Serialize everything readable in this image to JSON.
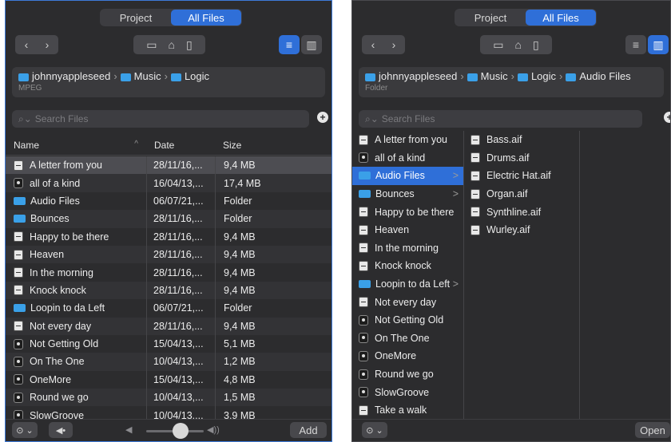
{
  "tabs": {
    "project": "Project",
    "all_files": "All Files"
  },
  "toolbar": {
    "back": "‹",
    "forward": "›",
    "computer_icon": "computer-icon",
    "home_icon": "home-icon",
    "document_icon": "document-icon",
    "list_icon": "list-view-icon",
    "column_icon": "column-view-icon"
  },
  "left": {
    "path": {
      "user": "johnnyappleseed",
      "music": "Music",
      "logic": "Logic"
    },
    "kind": "MPEG",
    "search_placeholder": "Search Files",
    "columns": {
      "name": "Name",
      "date": "Date",
      "size": "Size",
      "sort_indicator": "^"
    },
    "rows": [
      {
        "name": "A letter from you",
        "date": "28/11/16,...",
        "size": "9,4 MB",
        "type": "audio"
      },
      {
        "name": "all of a kind",
        "date": "16/04/13,...",
        "size": "17,4 MB",
        "type": "logic"
      },
      {
        "name": "Audio Files",
        "date": "06/07/21,...",
        "size": "Folder",
        "type": "folder"
      },
      {
        "name": "Bounces",
        "date": "28/11/16,...",
        "size": "Folder",
        "type": "folder"
      },
      {
        "name": "Happy to be there",
        "date": "28/11/16,...",
        "size": "9,4 MB",
        "type": "audio"
      },
      {
        "name": "Heaven",
        "date": "28/11/16,...",
        "size": "9,4 MB",
        "type": "audio"
      },
      {
        "name": "In the morning",
        "date": "28/11/16,...",
        "size": "9,4 MB",
        "type": "audio"
      },
      {
        "name": "Knock knock",
        "date": "28/11/16,...",
        "size": "9,4 MB",
        "type": "audio"
      },
      {
        "name": "Loopin to da Left",
        "date": "06/07/21,...",
        "size": "Folder",
        "type": "folder"
      },
      {
        "name": "Not every day",
        "date": "28/11/16,...",
        "size": "9,4 MB",
        "type": "audio"
      },
      {
        "name": "Not Getting Old",
        "date": "15/04/13,...",
        "size": "5,1 MB",
        "type": "logic"
      },
      {
        "name": "On The One",
        "date": "10/04/13,...",
        "size": "1,2 MB",
        "type": "logic"
      },
      {
        "name": "OneMore",
        "date": "15/04/13,...",
        "size": "4,8 MB",
        "type": "logic"
      },
      {
        "name": "Round we go",
        "date": "10/04/13,...",
        "size": "1,5 MB",
        "type": "logic"
      },
      {
        "name": "SlowGroove",
        "date": "10/04/13,...",
        "size": "3,9 MB",
        "type": "logic"
      }
    ],
    "add_label": "Add",
    "options_label": "⊙ ⌄",
    "play_label": "◀•"
  },
  "right": {
    "path": {
      "user": "johnnyappleseed",
      "music": "Music",
      "logic": "Logic",
      "audio": "Audio Files"
    },
    "kind": "Folder",
    "search_placeholder": "Search Files",
    "col1": [
      {
        "name": "A letter from you",
        "type": "audio"
      },
      {
        "name": "all of a kind",
        "type": "logic"
      },
      {
        "name": "Audio Files",
        "type": "folder",
        "arrow": ">"
      },
      {
        "name": "Bounces",
        "type": "folder",
        "arrow": ">"
      },
      {
        "name": "Happy to be there",
        "type": "audio"
      },
      {
        "name": "Heaven",
        "type": "audio"
      },
      {
        "name": "In the morning",
        "type": "audio"
      },
      {
        "name": "Knock knock",
        "type": "audio"
      },
      {
        "name": "Loopin to da Left",
        "type": "folder",
        "arrow": ">"
      },
      {
        "name": "Not every day",
        "type": "audio"
      },
      {
        "name": "Not Getting Old",
        "type": "logic"
      },
      {
        "name": "On The One",
        "type": "logic"
      },
      {
        "name": "OneMore",
        "type": "logic"
      },
      {
        "name": "Round we go",
        "type": "logic"
      },
      {
        "name": "SlowGroove",
        "type": "logic"
      },
      {
        "name": "Take a walk",
        "type": "audio"
      }
    ],
    "col2": [
      {
        "name": "Bass.aif",
        "type": "audio"
      },
      {
        "name": "Drums.aif",
        "type": "audio"
      },
      {
        "name": "Electric Hat.aif",
        "type": "audio"
      },
      {
        "name": "Organ.aif",
        "type": "audio"
      },
      {
        "name": "Synthline.aif",
        "type": "audio"
      },
      {
        "name": "Wurley.aif",
        "type": "audio"
      }
    ],
    "open_label": "Open",
    "options_label": "⊙ ⌄"
  }
}
